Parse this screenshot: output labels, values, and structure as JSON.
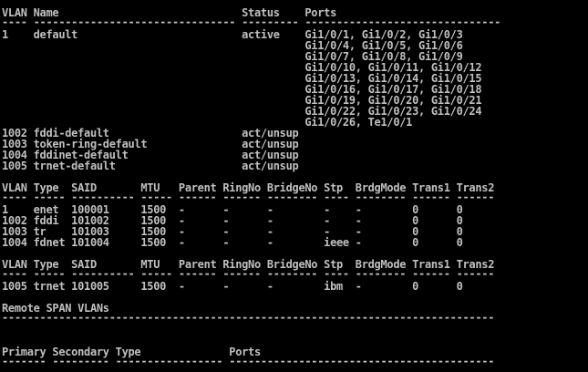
{
  "terminal": {
    "colors": {
      "background": "#000000",
      "foreground": "#c0c0c0"
    },
    "lines": [
      "VLAN Name                             Status    Ports",
      "---- -------------------------------- --------- -------------------------------",
      "1    default                          active    Gi1/0/1, Gi1/0/2, Gi1/0/3",
      "                                                Gi1/0/4, Gi1/0/5, Gi1/0/6",
      "                                                Gi1/0/7, Gi1/0/8, Gi1/0/9",
      "                                                Gi1/0/10, Gi1/0/11, Gi1/0/12",
      "                                                Gi1/0/13, Gi1/0/14, Gi1/0/15",
      "                                                Gi1/0/16, Gi1/0/17, Gi1/0/18",
      "                                                Gi1/0/19, Gi1/0/20, Gi1/0/21",
      "                                                Gi1/0/22, Gi1/0/23, Gi1/0/24",
      "                                                Gi1/0/26, Te1/0/1",
      "1002 fddi-default                     act/unsup",
      "1003 token-ring-default               act/unsup",
      "1004 fddinet-default                  act/unsup",
      "1005 trnet-default                    act/unsup",
      "",
      "VLAN Type  SAID       MTU   Parent RingNo BridgeNo Stp  BrdgMode Trans1 Trans2",
      "---- ----- ---------- ----- ------ ------ -------- ---- -------- ------ ------",
      "1    enet  100001     1500  -      -      -        -    -        0      0",
      "1002 fddi  101002     1500  -      -      -        -    -        0      0",
      "1003 tr    101003     1500  -      -      -        -    -        0      0",
      "1004 fdnet 101004     1500  -      -      -        ieee -        0      0",
      "",
      "VLAN Type  SAID       MTU   Parent RingNo BridgeNo Stp  BrdgMode Trans1 Trans2",
      "---- ----- ---------- ----- ------ ------ -------- ---- -------- ------ ------",
      "1005 trnet 101005     1500  -      -      -        ibm  -        0      0",
      "",
      "Remote SPAN VLANs",
      "------------------------------------------------------------------------------",
      "",
      "",
      "Primary Secondary Type              Ports",
      "------- --------- ----------------- ------------------------------------------"
    ]
  }
}
